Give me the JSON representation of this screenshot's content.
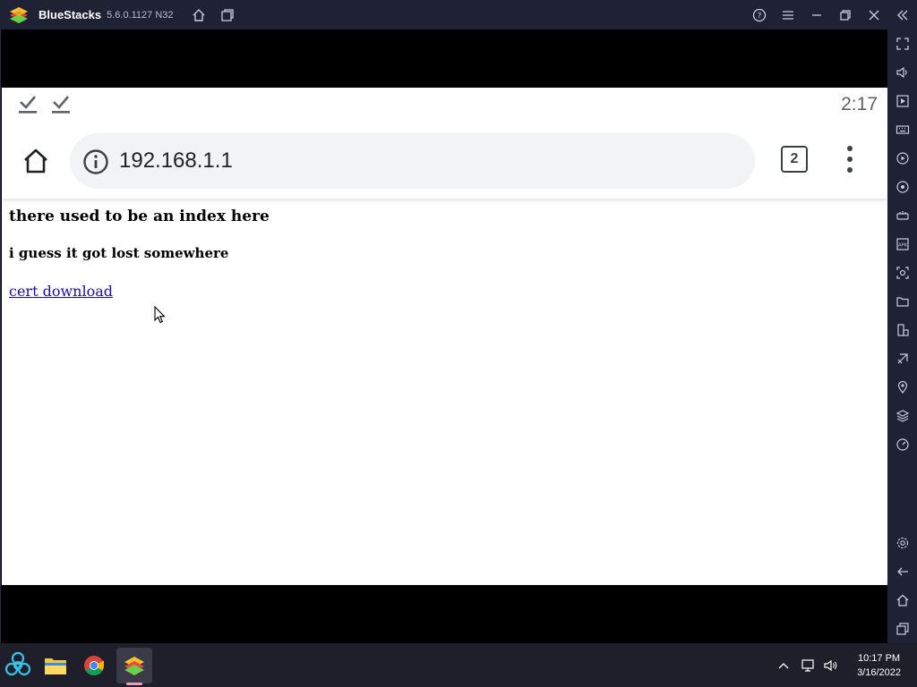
{
  "window": {
    "app_name": "BlueStacks",
    "version": "5.6.0.1127 N32"
  },
  "status_bar": {
    "time": "2:17"
  },
  "browser": {
    "url": "192.168.1.1",
    "tab_count": "2"
  },
  "page": {
    "heading": "there used to be an index here",
    "subheading": "i guess it got lost somewhere",
    "link_text": "cert download"
  },
  "sidebar": {
    "icons": [
      "fullscreen-icon",
      "volume-icon",
      "media-icon",
      "keyboard-icon",
      "macro-icon",
      "rotate-icon",
      "game-controls-icon",
      "apk-icon",
      "screenshot-icon",
      "folder-icon",
      "multi-instance-icon",
      "eco-mode-icon",
      "location-icon",
      "layers-icon",
      "performance-icon",
      "settings-icon",
      "back-icon",
      "home-icon",
      "recents-icon"
    ]
  },
  "taskbar": {
    "time": "10:17 PM",
    "date": "3/16/2022"
  },
  "colors": {
    "titlebar": "#1f2234",
    "link": "#1a0dab",
    "omnibox": "#f1f3f4"
  }
}
